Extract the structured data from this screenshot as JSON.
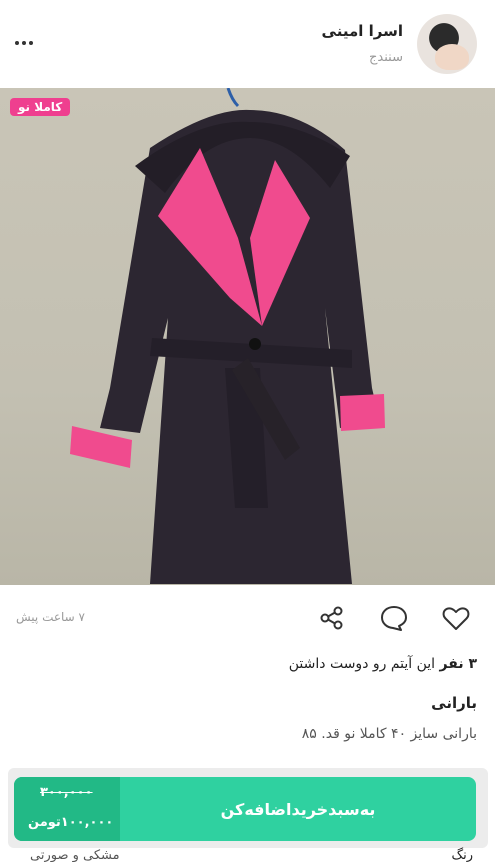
{
  "seller": {
    "name": "اسرا امینی",
    "city": "سنندج"
  },
  "listing": {
    "badge": "کاملا نو",
    "time_ago": "۷ ساعت پیش",
    "likes_count": "۳ نفر",
    "likes_text": " این آیتم رو دوست داشتن",
    "title": "بارانی",
    "description": "بارانی سایز ۴۰ کاملا نو قد. ۸۵"
  },
  "purchase": {
    "old_price": "۳۰۰,۰۰۰",
    "new_price": "۱۰۰,۰۰۰تومن",
    "button_label": "به‌سبد‌خرید‌اضافه‌کن"
  },
  "peek": {
    "right": "رنگ",
    "left": "مشکی و صورتی"
  },
  "icons": [
    "more-icon",
    "heart-icon",
    "comment-icon",
    "share-icon"
  ],
  "colors": {
    "accent_green": "#2fd1a0",
    "price_green": "#22b986",
    "badge_pink": "#ef3f8f"
  }
}
